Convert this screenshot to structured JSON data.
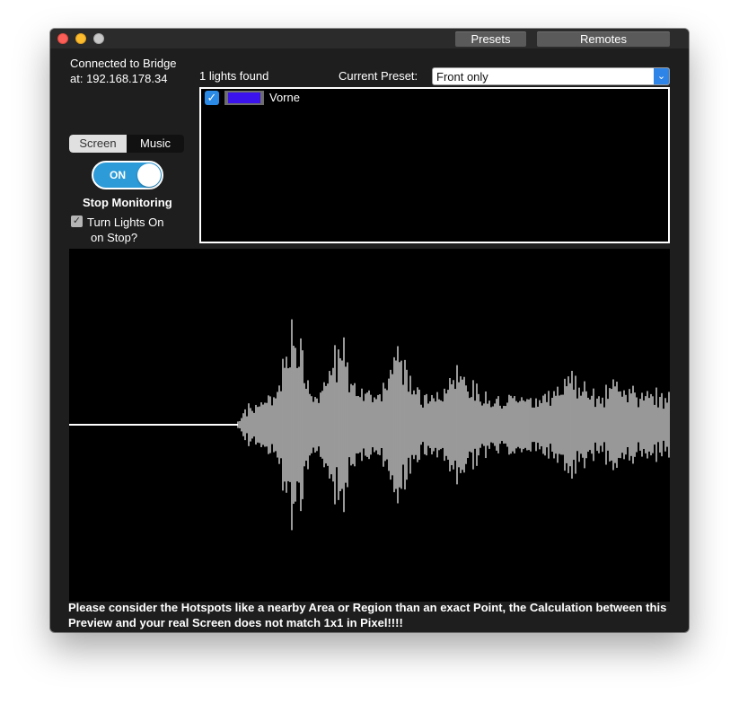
{
  "window": {
    "titlebar_buttons": {
      "presets": "Presets",
      "remotes": "Remotes"
    }
  },
  "bridge": {
    "status_line1": "Connected to Bridge",
    "status_line2": "at: 192.168.178.34"
  },
  "mode": {
    "segments": [
      "Screen",
      "Music"
    ],
    "selected": "Screen"
  },
  "monitor": {
    "toggle_label": "ON",
    "toggle_state": "on",
    "stop_label": "Stop Monitoring",
    "turn_on_label_line1": "Turn Lights On",
    "turn_on_label_line2": "on Stop?",
    "turn_on_checked": true
  },
  "lights": {
    "found_label": "1 lights found",
    "items": [
      {
        "name": "Vorne",
        "checked": true,
        "color": "#3b13ec"
      }
    ]
  },
  "preset": {
    "label": "Current Preset:",
    "value": "Front only"
  },
  "colors": {
    "accent": "#2f84e8",
    "toggle": "#2d9bd8",
    "window_bg": "#1e1e1e",
    "waveform": "#ffffff"
  },
  "footer": {
    "line1": "Please consider the Hotspots like a nearby Area or Region than an exact Point, the Calculation between this",
    "line2": "Preview and your real Screen does not match 1x1 in Pixel!!!!"
  }
}
